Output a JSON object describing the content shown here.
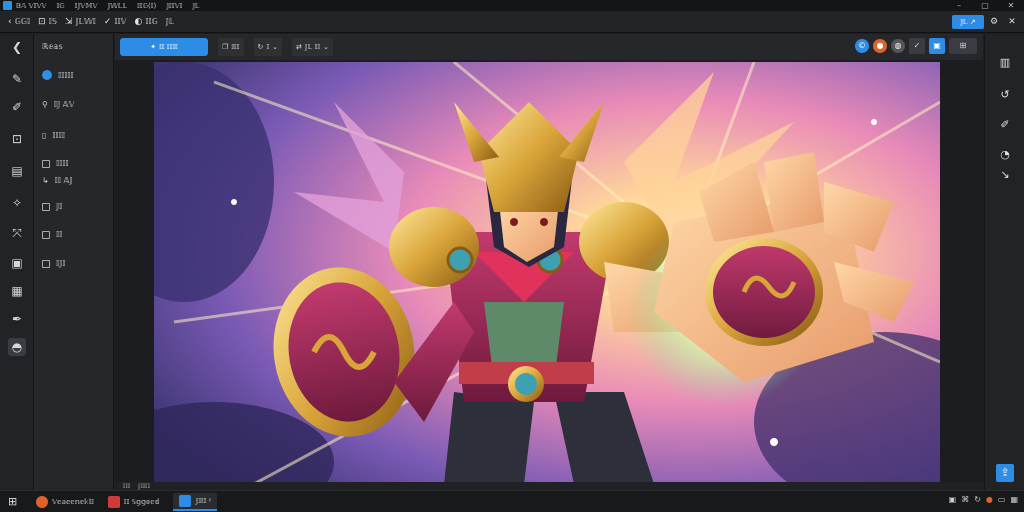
{
  "menubar": {
    "items": [
      "𝔹𝔸 𝕍𝕀𝕍𝕍",
      "𝕀𝔾",
      "𝕀𝕁𝕍𝕄𝕍",
      "𝕁𝕎𝕃𝕃",
      "𝕀𝕀𝔾(𝕀)",
      "𝕁𝕀𝕀𝕍𝕀",
      "𝕁𝕃"
    ],
    "window_controls": [
      "–",
      "▢",
      "✕"
    ]
  },
  "toolbar": {
    "items": [
      {
        "icon": "‹",
        "label": "𝔾𝔾𝕀"
      },
      {
        "icon": "⊡",
        "label": "𝕀𝕊"
      },
      {
        "icon": "⇲",
        "label": "𝕁𝕃𝕎𝕀"
      },
      {
        "icon": "✓",
        "label": "𝕀𝕀𝕍"
      },
      {
        "icon": "◐",
        "label": "𝕀𝕀𝔾"
      },
      {
        "icon": "",
        "label": "𝕁𝕃"
      }
    ],
    "share_label": "𝕁𝕃 ↗"
  },
  "left_rail": {
    "icons": [
      "back-arrow-icon",
      "brush-icon",
      "eraser-icon",
      "crop-icon",
      "layers-icon",
      "magic-wand-icon",
      "transform-icon",
      "image-icon",
      "text-icon",
      "pen-icon",
      "mask-icon"
    ]
  },
  "left_panel": {
    "header": "ℝ𝕖𝕒𝕤",
    "items": [
      "𝕀𝕀𝕀𝕀𝕀",
      "𝕀𝕁 𝔸𝕍",
      "𝕀𝕀𝕀𝕀",
      "𝕀𝕀𝕀𝕀",
      "𝕀𝕀 𝔸𝕁",
      "𝕁𝕀",
      "𝕀𝕀",
      "𝕀𝕁𝕀"
    ]
  },
  "canvas_toolbar": {
    "primary_label": "𝕀𝕀 𝕀𝕀𝕀𝕀",
    "tools": [
      "𝕀𝕀𝕀",
      "𝕀",
      "𝕁𝕃 𝕀𝕀"
    ]
  },
  "status": {
    "items": [
      "𝕀𝕀𝕀",
      "𝕁𝕀𝕀𝕀𝕀"
    ]
  },
  "taskbar": {
    "apps": [
      {
        "label": "𝕍𝕖𝕒𝕖𝕖𝕟𝕖𝕜𝕝𝕀",
        "color": "#e0612a"
      },
      {
        "label": "𝕀𝕀 𝕊𝕘𝕘𝕠𝕖𝕕",
        "color": "#d23a3a"
      },
      {
        "label": "𝕁𝕀𝕀𝕀 ʸ",
        "color": "#2d8ce6"
      }
    ]
  },
  "colors": {
    "accent": "#2d8ce6",
    "background": "#1e1f22",
    "panel": "#26272b"
  }
}
